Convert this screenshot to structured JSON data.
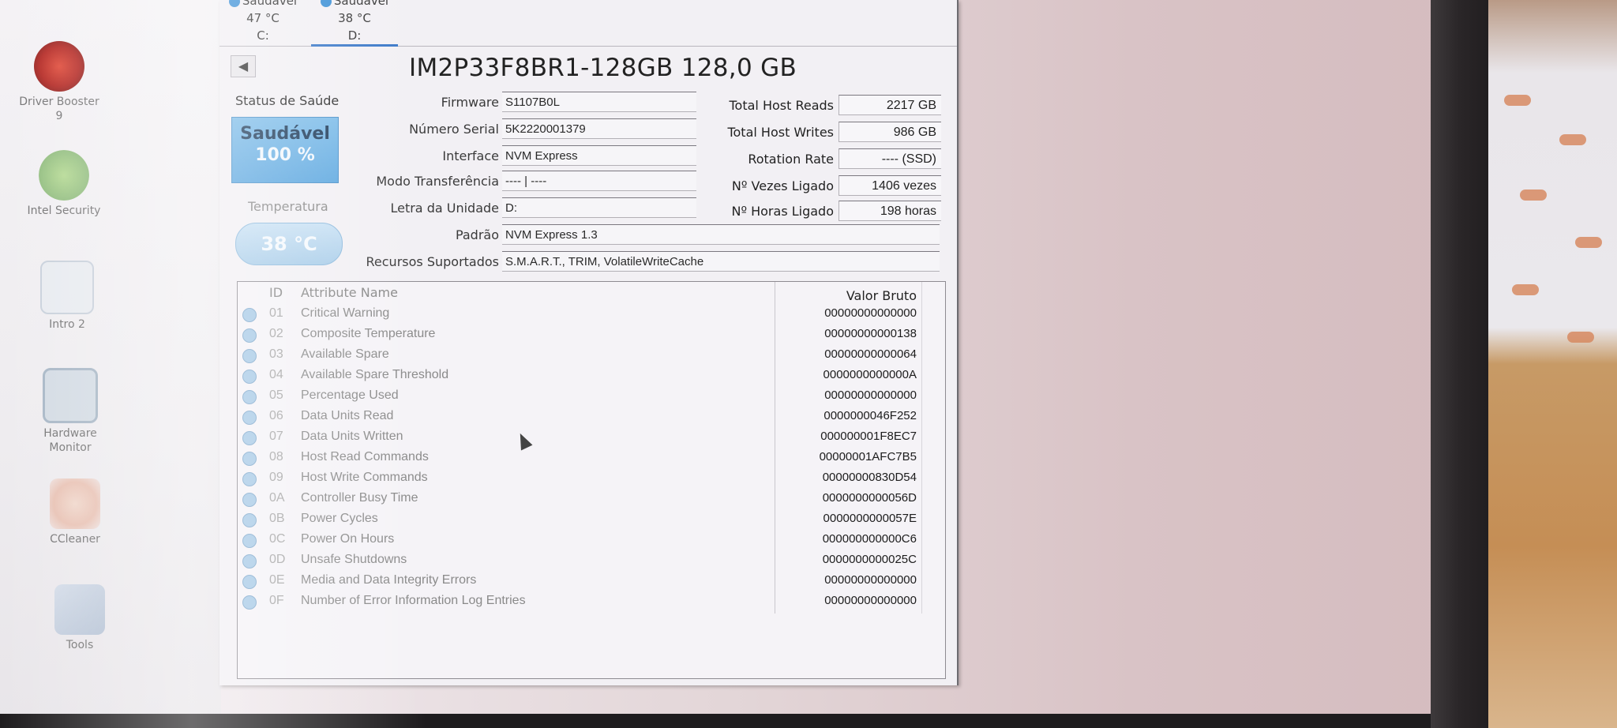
{
  "desktop": {
    "icons": [
      {
        "label": "Driver Booster 9"
      },
      {
        "label": "Intel Security"
      },
      {
        "label": "Intro 2"
      },
      {
        "label": "Hardware Monitor"
      },
      {
        "label": "CCleaner"
      },
      {
        "label": "Tools"
      }
    ]
  },
  "tabs": [
    {
      "status": "Saudável",
      "temp": "47 °C",
      "drive": "C:"
    },
    {
      "status": "Saudável",
      "temp": "38 °C",
      "drive": "D:"
    }
  ],
  "window": {
    "title": "IM2P33F8BR1-128GB 128,0 GB",
    "health_label": "Status de Saúde",
    "health_status": "Saudável",
    "health_percent": "100 %",
    "temp_label": "Temperatura",
    "temp_value": "38 °C",
    "fields": {
      "firmware_label": "Firmware",
      "firmware": "S1107B0L",
      "serial_label": "Número Serial",
      "serial": "5K2220001379",
      "interface_label": "Interface",
      "interface": "NVM Express",
      "transfer_label": "Modo Transferência",
      "transfer": "---- | ----",
      "drive_letter_label": "Letra da Unidade",
      "drive_letter": "D:",
      "standard_label": "Padrão",
      "standard": "NVM Express 1.3",
      "features_label": "Recursos Suportados",
      "features": "S.M.A.R.T., TRIM, VolatileWriteCache"
    },
    "right": {
      "reads_label": "Total Host Reads",
      "reads": "2217 GB",
      "writes_label": "Total Host Writes",
      "writes": "986 GB",
      "rotation_label": "Rotation Rate",
      "rotation": "---- (SSD)",
      "power_count_label": "Nº Vezes Ligado",
      "power_count": "1406 vezes",
      "power_hours_label": "Nº Horas Ligado",
      "power_hours": "198 horas"
    }
  },
  "smart": {
    "headers": {
      "id": "ID",
      "name": "Attribute Name",
      "raw": "Valor Bruto"
    },
    "rows": [
      {
        "id": "01",
        "name": "Critical Warning",
        "raw": "00000000000000"
      },
      {
        "id": "02",
        "name": "Composite Temperature",
        "raw": "00000000000138"
      },
      {
        "id": "03",
        "name": "Available Spare",
        "raw": "00000000000064"
      },
      {
        "id": "04",
        "name": "Available Spare Threshold",
        "raw": "0000000000000A"
      },
      {
        "id": "05",
        "name": "Percentage Used",
        "raw": "00000000000000"
      },
      {
        "id": "06",
        "name": "Data Units Read",
        "raw": "0000000046F252"
      },
      {
        "id": "07",
        "name": "Data Units Written",
        "raw": "000000001F8EC7"
      },
      {
        "id": "08",
        "name": "Host Read Commands",
        "raw": "00000001AFC7B5"
      },
      {
        "id": "09",
        "name": "Host Write Commands",
        "raw": "00000000830D54"
      },
      {
        "id": "0A",
        "name": "Controller Busy Time",
        "raw": "0000000000056D"
      },
      {
        "id": "0B",
        "name": "Power Cycles",
        "raw": "0000000000057E"
      },
      {
        "id": "0C",
        "name": "Power On Hours",
        "raw": "000000000000C6"
      },
      {
        "id": "0D",
        "name": "Unsafe Shutdowns",
        "raw": "0000000000025C"
      },
      {
        "id": "0E",
        "name": "Media and Data Integrity Errors",
        "raw": "00000000000000"
      },
      {
        "id": "0F",
        "name": "Number of Error Information Log Entries",
        "raw": "00000000000000"
      }
    ]
  },
  "colors": {
    "health_blue": "#5ea8e0",
    "status_dot": "#3a8fd6"
  }
}
